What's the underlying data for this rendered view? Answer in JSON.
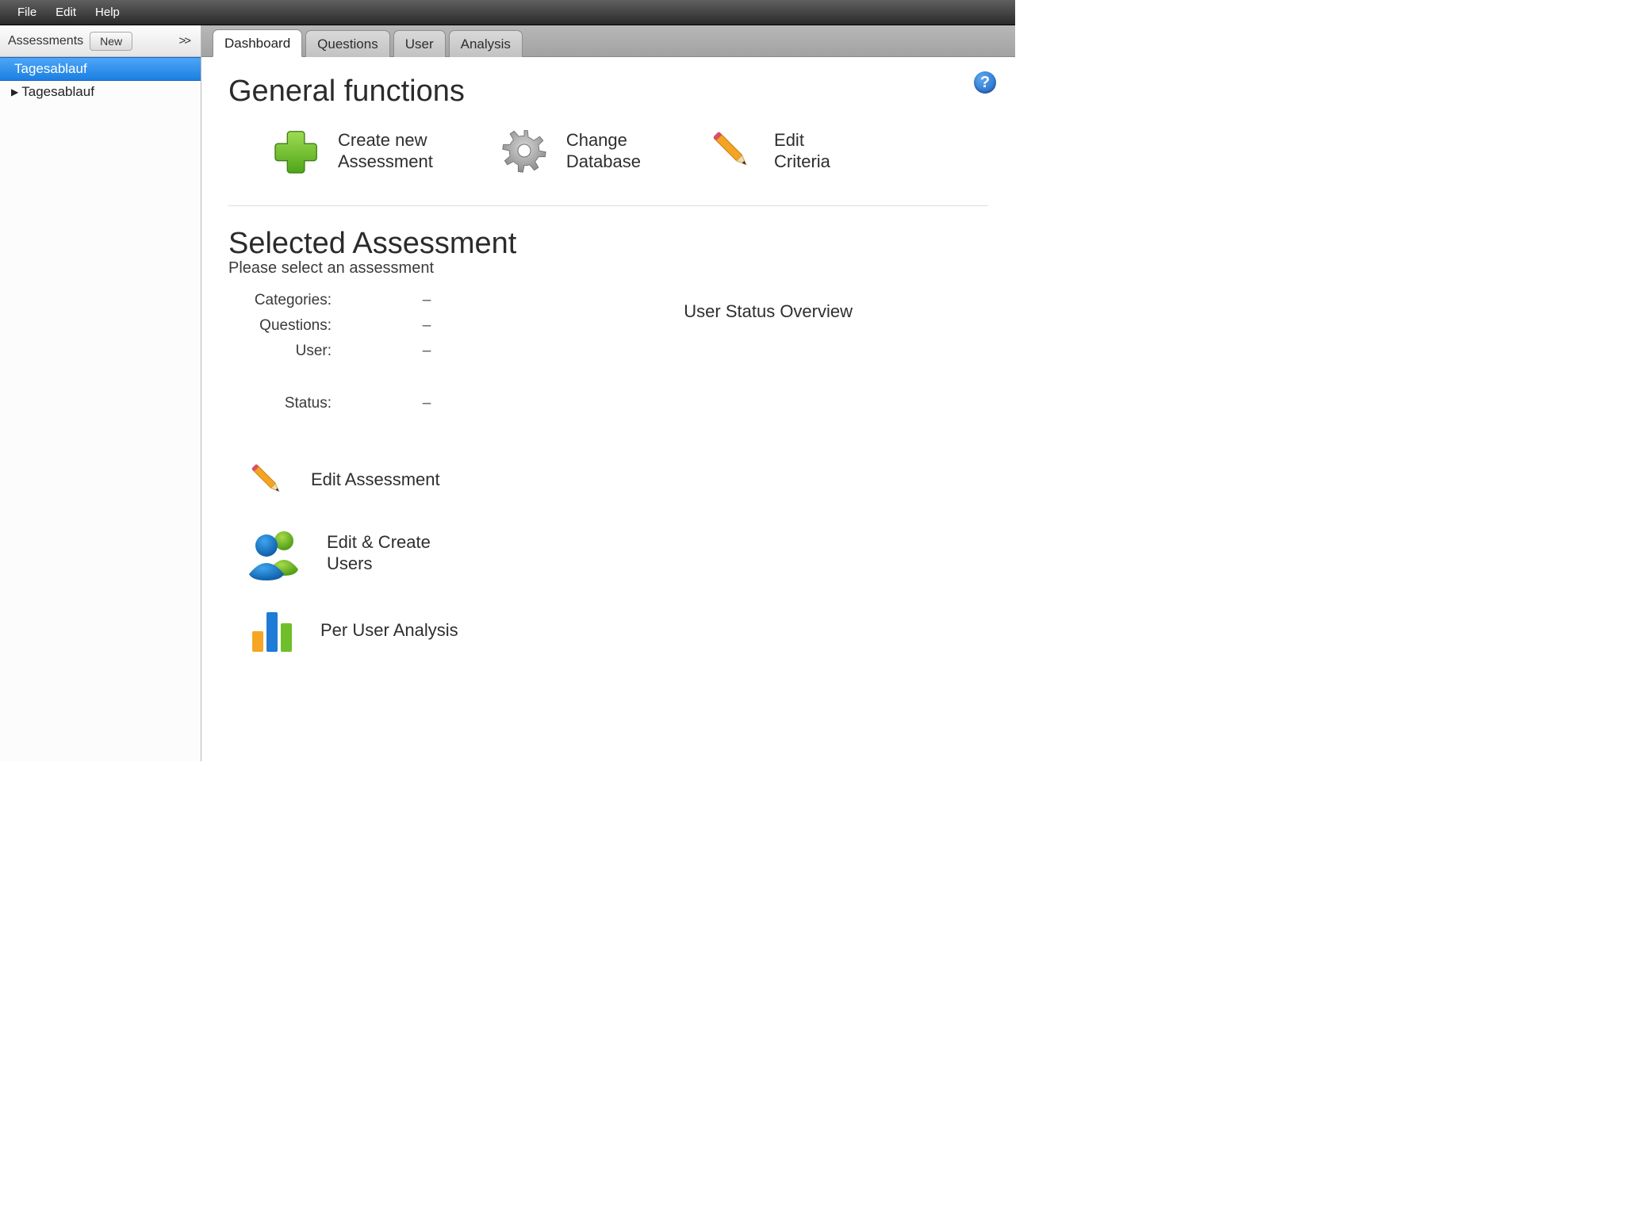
{
  "menubar": {
    "file": "File",
    "edit": "Edit",
    "help": "Help"
  },
  "sidebar": {
    "header_label": "Assessments",
    "new_button": "New",
    "collapse_glyph": ">>",
    "selected_item": "Tagesablauf",
    "items": [
      {
        "label": "Tagesablauf"
      }
    ]
  },
  "tabs": [
    {
      "label": "Dashboard",
      "active": true
    },
    {
      "label": "Questions",
      "active": false
    },
    {
      "label": "User",
      "active": false
    },
    {
      "label": "Analysis",
      "active": false
    }
  ],
  "help_badge": "?",
  "general_functions": {
    "heading": "General functions",
    "items": [
      {
        "line1": "Create new",
        "line2": "Assessment"
      },
      {
        "line1": "Change",
        "line2": "Database"
      },
      {
        "line1": "Edit",
        "line2": "Criteria"
      }
    ]
  },
  "selected_assessment": {
    "heading": "Selected Assessment",
    "subtitle": "Please select an assessment",
    "rows": {
      "categories_label": "Categories:",
      "categories_value": "–",
      "questions_label": "Questions:",
      "questions_value": "–",
      "user_label": "User:",
      "user_value": "–",
      "status_label": "Status:",
      "status_value": "–"
    },
    "user_status_overview": "User Status Overview",
    "actions": [
      {
        "label": "Edit Assessment"
      },
      {
        "line1": "Edit & Create",
        "line2": "Users"
      },
      {
        "label": "Per User Analysis"
      }
    ]
  }
}
